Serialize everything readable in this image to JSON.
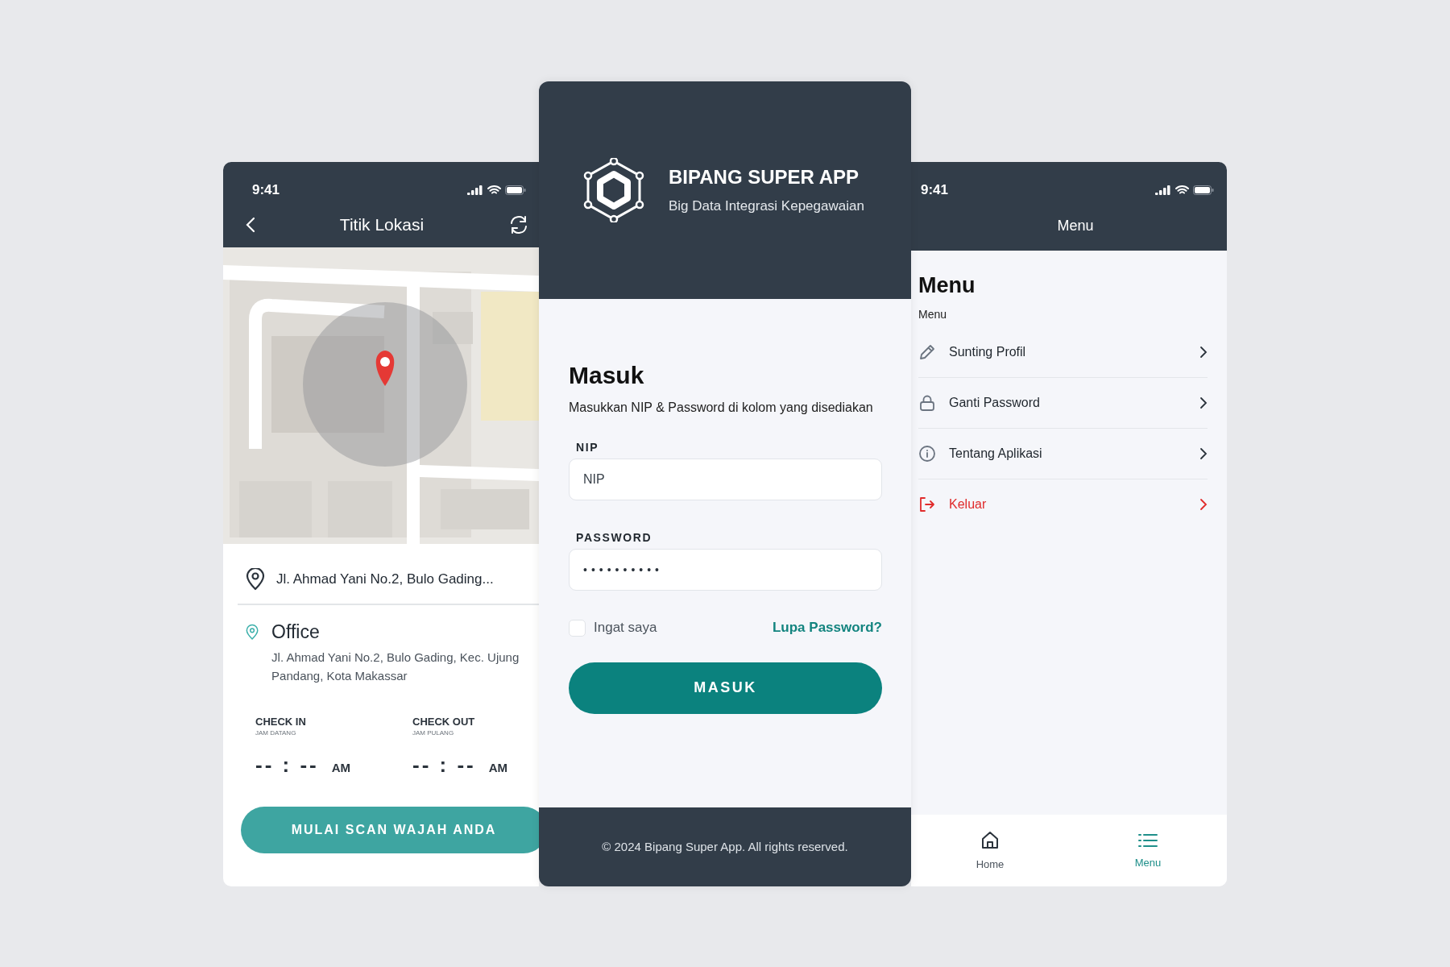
{
  "location_screen": {
    "status_bar": {
      "time": "9:41"
    },
    "header": {
      "title": "Titik Lokasi"
    },
    "current_address": "Jl. Ahmad Yani No.2, Bulo Gading...",
    "office": {
      "name": "Office",
      "address": "Jl. Ahmad Yani No.2, Bulo Gading, Kec. Ujung Pandang, Kota Makassar"
    },
    "attendance": [
      {
        "label": "CHECK IN",
        "sublabel": "JAM DATANG",
        "time": "-- : --",
        "period": "AM"
      },
      {
        "label": "CHECK OUT",
        "sublabel": "JAM PULANG",
        "time": "-- : --",
        "period": "AM"
      }
    ],
    "scan_button": "MULAI SCAN WAJAH ANDA"
  },
  "login_screen": {
    "brand": {
      "name": "BIPANG SUPER APP",
      "tagline": "Big Data Integrasi Kepegawaian"
    },
    "title": "Masuk",
    "subtitle": "Masukkan NIP & Password di kolom yang disediakan",
    "fields": [
      {
        "label": "NIP",
        "kind": "text",
        "placeholder": "NIP"
      },
      {
        "label": "PASSWORD",
        "kind": "password",
        "value": "••••••••••"
      }
    ],
    "remember": {
      "label": "Ingat saya",
      "checked": false
    },
    "forgot_link": "Lupa Password?",
    "submit_button": "MASUK",
    "footer": "© 2024 Bipang Super App. All rights reserved."
  },
  "menu_screen": {
    "status_bar": {
      "time": "9:41"
    },
    "header": {
      "title": "Menu"
    },
    "heading": "Menu",
    "subheading": "Menu",
    "items": [
      {
        "label": "Sunting Profil",
        "kind": "edit",
        "danger": false
      },
      {
        "label": "Ganti Password",
        "kind": "lock",
        "danger": false
      },
      {
        "label": "Tentang Aplikasi",
        "kind": "info",
        "danger": false
      },
      {
        "label": "Keluar",
        "kind": "logout",
        "danger": true
      }
    ],
    "bottom_nav": [
      {
        "label": "Home",
        "kind": "home",
        "selected": false
      },
      {
        "label": "Menu",
        "kind": "menu",
        "selected": true
      }
    ]
  }
}
